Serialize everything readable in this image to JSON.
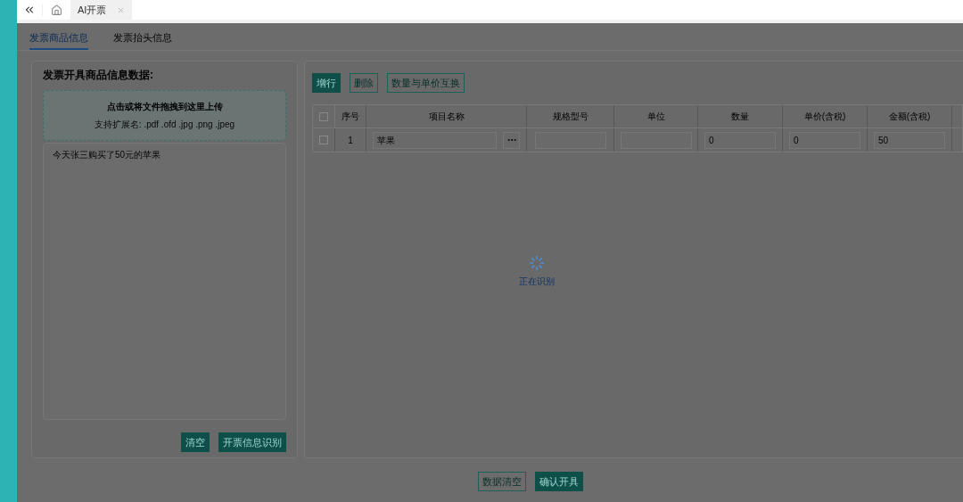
{
  "top_tabs": [
    {
      "label": "AI开票",
      "selected": true
    }
  ],
  "section_tabs": [
    {
      "label": "发票商品信息",
      "selected": true
    },
    {
      "label": "发票抬头信息",
      "selected": false
    }
  ],
  "left_panel": {
    "title": "发票开具商品信息数据:",
    "upload": {
      "title": "点击或将文件拖拽到这里上传",
      "hint": "支持扩展名: .pdf .ofd .jpg .png .jpeg"
    },
    "text": "今天张三购买了50元的苹果",
    "buttons": [
      {
        "label": "清空",
        "kind": "primary"
      },
      {
        "label": "开票信息识别",
        "kind": "primary"
      }
    ]
  },
  "toolbar": [
    {
      "label": "增行",
      "kind": "primary"
    },
    {
      "label": "删除",
      "kind": "outline"
    },
    {
      "label": "数量与单价互换",
      "kind": "outline"
    }
  ],
  "table": {
    "all_checked": false,
    "columns": [
      "序号",
      "项目名称",
      "规格型号",
      "单位",
      "数量",
      "单价(含税)",
      "金额(含税)"
    ],
    "rows": [
      {
        "checked": false,
        "index": "1",
        "name": "苹果",
        "spec": "",
        "unit": "",
        "quantity": "0",
        "price": "0",
        "amount": "50"
      }
    ]
  },
  "loading": {
    "text": "正在识别"
  },
  "footer_buttons": [
    {
      "label": "数据清空",
      "kind": "outline"
    },
    {
      "label": "确认开具",
      "kind": "primary"
    }
  ]
}
